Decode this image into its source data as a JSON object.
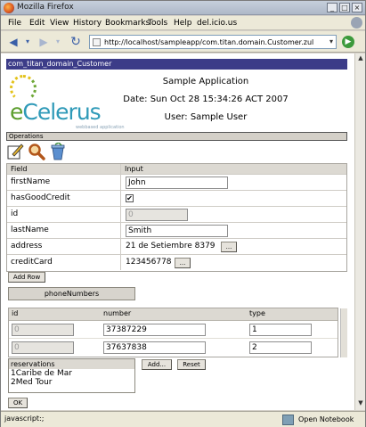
{
  "window": {
    "title": "Mozilla Firefox"
  },
  "menu": [
    "File",
    "Edit",
    "View",
    "History",
    "Bookmarks",
    "Tools",
    "Help",
    "del.icio.us"
  ],
  "nav": {
    "url": "http://localhost/sampleapp/com.titan.domain.Customer.zul"
  },
  "page": {
    "header_bar": "com_titan_domain_Customer",
    "logo_text": "eCelerus",
    "logo_tagline": "webbased application",
    "app_title": "Sample Application",
    "date_line": "Date: Sun Oct 28 15:34:26 ACT 2007",
    "user_line": "User: Sample User",
    "operations_label": "Operations",
    "operation_icons": [
      "edit-icon",
      "search-icon",
      "delete-icon"
    ]
  },
  "form": {
    "col_field": "Field",
    "col_input": "Input",
    "first_name_label": "firstName",
    "first_name_value": "John",
    "has_good_credit_label": "hasGoodCredit",
    "has_good_credit_mark": "✔",
    "id_label": "id",
    "id_value": "0",
    "last_name_label": "lastName",
    "last_name_value": "Smith",
    "address_label": "address",
    "address_value": "21 de Setiembre 8379",
    "credit_card_label": "creditCard",
    "credit_card_value": "123456778",
    "ellipsis": "...",
    "add_row": "Add Row"
  },
  "phone": {
    "button": "phoneNumbers",
    "col_id": "id",
    "col_number": "number",
    "col_type": "type",
    "rows": [
      {
        "id": "0",
        "number": "37387229",
        "type": "1"
      },
      {
        "id": "0",
        "number": "37637838",
        "type": "2"
      }
    ]
  },
  "reservations": {
    "caption": "reservations",
    "items": [
      "1Caribe de Mar",
      "2Med Tour"
    ],
    "add_button": "Add...",
    "reset_button": "Reset"
  },
  "ok_button": "OK",
  "status": {
    "text": "javascript:;",
    "notebook": "Open Notebook"
  }
}
